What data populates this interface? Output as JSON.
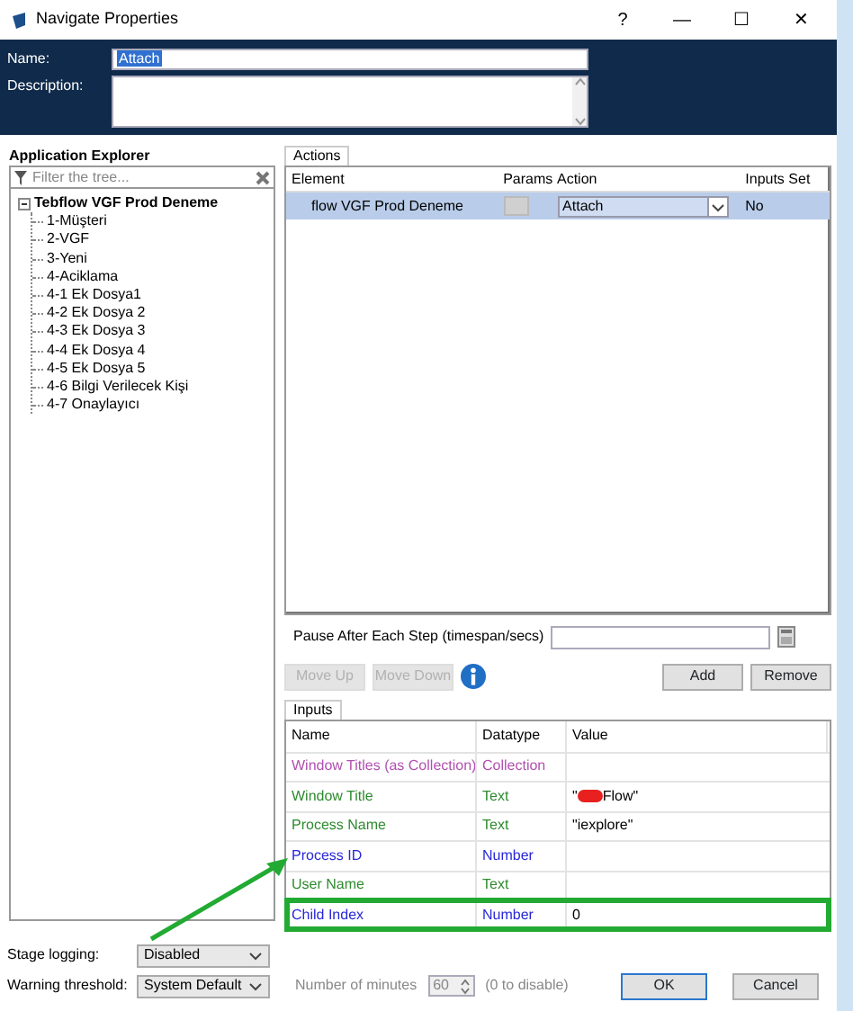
{
  "window": {
    "title": "Navigate Properties",
    "controls": [
      "?",
      "—",
      "☐",
      "✕"
    ]
  },
  "name_field": {
    "label": "Name:",
    "value": "Attach",
    "selected": true
  },
  "description_field": {
    "label": "Description:"
  },
  "explorer": {
    "title": "Application Explorer",
    "filter_placeholder": "Filter the tree...",
    "tree": [
      {
        "label": "Tebflow VGF Prod Deneme",
        "expanded": true,
        "children": [
          {
            "label": "1-Müşteri"
          },
          {
            "label": "2-VGF"
          },
          {
            "label": "3-Yeni"
          },
          {
            "label": "4-Aciklama"
          },
          {
            "label": "4-1 Ek Dosya1"
          },
          {
            "label": "4-2 Ek Dosya 2"
          },
          {
            "label": "4-3 Ek Dosya 3"
          },
          {
            "label": "4-4 Ek Dosya 4"
          },
          {
            "label": "4-5 Ek Dosya 5"
          },
          {
            "label": "4-6 Bilgi Verilecek Kişi"
          },
          {
            "label": "4-7 Onaylayıcı"
          }
        ]
      }
    ]
  },
  "actions": {
    "tab": "Actions",
    "columns": [
      "Element",
      "Params",
      "Action",
      "Inputs Set"
    ],
    "rows": [
      {
        "element": "flow VGF Prod Deneme",
        "action": "Attach",
        "inputs_set": "No",
        "selected": true
      }
    ]
  },
  "pause": {
    "label": "Pause After Each Step (timespan/secs)"
  },
  "buttons": [
    {
      "label": "Move Up",
      "disabled": true
    },
    {
      "label": "Move Down",
      "disabled": true
    },
    {
      "label": "Add",
      "disabled": false
    },
    {
      "label": "Remove",
      "disabled": false
    }
  ],
  "inputs": {
    "tab": "Inputs",
    "columns": [
      "Name",
      "Datatype",
      "Value"
    ],
    "rows": [
      {
        "name": "Window Titles (as Collection)",
        "datatype": "Collection",
        "color": "#b050b0",
        "highlighted": false
      },
      {
        "name": "Window Title",
        "datatype": "Text",
        "value": "\"",
        "redacted": true,
        "value_after": "Flow\"",
        "color": "#2e8b2e",
        "highlighted": false
      },
      {
        "name": "Process Name",
        "datatype": "Text",
        "value": "\"iexplore\"",
        "color": "#2e8b2e",
        "highlighted": false
      },
      {
        "name": "Process ID",
        "datatype": "Number",
        "color": "#2828d8",
        "highlighted": false
      },
      {
        "name": "User Name",
        "datatype": "Text",
        "color": "#2e8b2e",
        "highlighted": false
      },
      {
        "name": "Child Index",
        "datatype": "Number",
        "value": "0",
        "color": "#2828d8",
        "highlighted": true
      }
    ]
  },
  "stage_logging": {
    "label": "Stage logging:",
    "value": "Disabled"
  },
  "warning": {
    "label": "Warning threshold:",
    "value": "System Default",
    "minutes_label": "Number of minutes",
    "minutes": "60",
    "minutes_disabled": true,
    "hint": "(0 to disable)"
  },
  "dialog_buttons": [
    {
      "label": "OK",
      "default": true
    },
    {
      "label": "Cancel",
      "default": false
    }
  ]
}
